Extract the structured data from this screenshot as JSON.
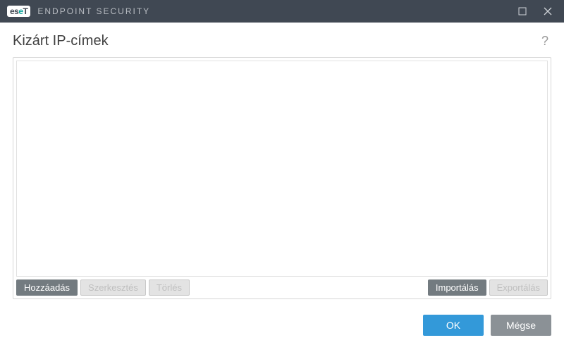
{
  "titlebar": {
    "brand_prefix": "es",
    "brand_mid": "e",
    "brand_suffix": "T",
    "product": "ENDPOINT SECURITY"
  },
  "page": {
    "title": "Kizárt IP-címek",
    "help": "?"
  },
  "actions": {
    "add": "Hozzáadás",
    "edit": "Szerkesztés",
    "delete": "Törlés",
    "import": "Importálás",
    "export": "Exportálás"
  },
  "dialog": {
    "ok": "OK",
    "cancel": "Mégse"
  }
}
